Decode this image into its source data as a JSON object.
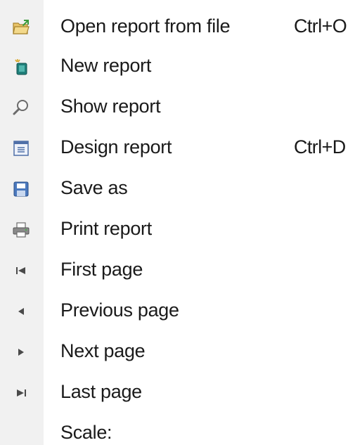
{
  "menu": {
    "items": [
      {
        "label": "Open report from file",
        "shortcut": "Ctrl+O",
        "icon": "open-folder-icon"
      },
      {
        "label": "New report",
        "shortcut": "",
        "icon": "new-report-icon"
      },
      {
        "label": "Show report",
        "shortcut": "",
        "icon": "magnifier-icon"
      },
      {
        "label": "Design report",
        "shortcut": "Ctrl+D",
        "icon": "design-form-icon"
      },
      {
        "label": "Save as",
        "shortcut": "",
        "icon": "floppy-disk-icon"
      },
      {
        "label": "Print report",
        "shortcut": "",
        "icon": "printer-icon"
      },
      {
        "label": "First page",
        "shortcut": "",
        "icon": "first-page-icon"
      },
      {
        "label": "Previous page",
        "shortcut": "",
        "icon": "previous-page-icon"
      },
      {
        "label": "Next page",
        "shortcut": "",
        "icon": "next-page-icon"
      },
      {
        "label": "Last page",
        "shortcut": "",
        "icon": "last-page-icon"
      },
      {
        "label": "Scale:",
        "shortcut": "",
        "icon": ""
      }
    ]
  },
  "colors": {
    "gutter": "#f1f1f1",
    "text": "#1a1a1a",
    "folder": "#e2b24a",
    "book": "#2c8f8a",
    "floppy": "#3d6fb4"
  }
}
